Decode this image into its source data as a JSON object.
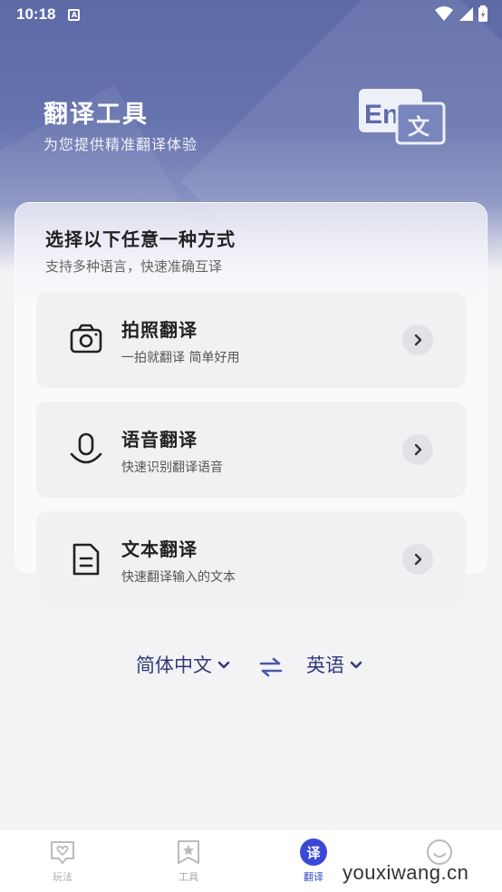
{
  "status_bar": {
    "time": "10:18",
    "notification_badge": "A"
  },
  "header": {
    "title": "翻译工具",
    "subtitle": "为您提供精准翻译体验",
    "logo_text_en": "En",
    "logo_text_zh": "文"
  },
  "card": {
    "title": "选择以下任意一种方式",
    "subtitle": "支持多种语言，快速准确互译",
    "options": [
      {
        "label": "拍照翻译",
        "desc": "一拍就翻译 简单好用",
        "icon": "camera-icon"
      },
      {
        "label": "语音翻译",
        "desc": "快速识别翻译语音",
        "icon": "microphone-icon"
      },
      {
        "label": "文本翻译",
        "desc": "快速翻译输入的文本",
        "icon": "document-icon"
      }
    ]
  },
  "languages": {
    "source": "简体中文",
    "target": "英语"
  },
  "tabbar": {
    "tabs": [
      {
        "label": "玩法",
        "icon": "heart-chat-icon"
      },
      {
        "label": "工具",
        "icon": "bookmark-star-icon"
      },
      {
        "label": "翻译",
        "icon": "translate-badge-icon",
        "badge": "译",
        "active": true
      },
      {
        "label": "",
        "icon": "smile-icon"
      }
    ]
  },
  "watermark": "youxiwang.cn",
  "colors": {
    "accent": "#3b48d6",
    "hero": "#5d6aa6",
    "lang_text": "#2f3a7a"
  }
}
